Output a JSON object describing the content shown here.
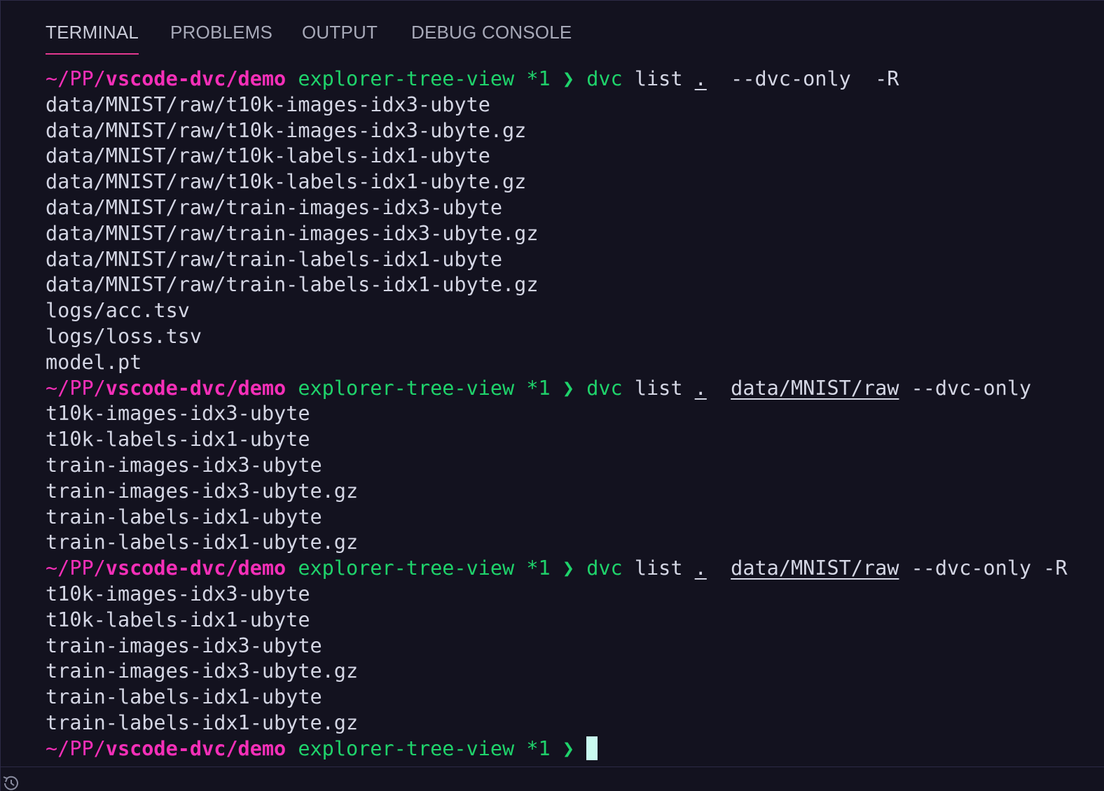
{
  "tabs": [
    {
      "label": "TERMINAL",
      "active": true
    },
    {
      "label": "PROBLEMS",
      "active": false
    },
    {
      "label": "OUTPUT",
      "active": false
    },
    {
      "label": "DEBUG CONSOLE",
      "active": false
    }
  ],
  "prompt": {
    "path_prefix": "~/PP/",
    "path_bold": "vscode-dvc/demo",
    "branch": "explorer-tree-view *1",
    "arrow": "❯"
  },
  "commands": [
    {
      "cmd": "dvc",
      "sub": "list",
      "dot": ".",
      "path": "",
      "flags": "--dvc-only  -R",
      "output": [
        "data/MNIST/raw/t10k-images-idx3-ubyte",
        "data/MNIST/raw/t10k-images-idx3-ubyte.gz",
        "data/MNIST/raw/t10k-labels-idx1-ubyte",
        "data/MNIST/raw/t10k-labels-idx1-ubyte.gz",
        "data/MNIST/raw/train-images-idx3-ubyte",
        "data/MNIST/raw/train-images-idx3-ubyte.gz",
        "data/MNIST/raw/train-labels-idx1-ubyte",
        "data/MNIST/raw/train-labels-idx1-ubyte.gz",
        "logs/acc.tsv",
        "logs/loss.tsv",
        "model.pt"
      ]
    },
    {
      "cmd": "dvc",
      "sub": "list",
      "dot": ".",
      "path": "data/MNIST/raw",
      "flags": "--dvc-only",
      "output": [
        "t10k-images-idx3-ubyte",
        "t10k-labels-idx1-ubyte",
        "train-images-idx3-ubyte",
        "train-images-idx3-ubyte.gz",
        "train-labels-idx1-ubyte",
        "train-labels-idx1-ubyte.gz"
      ]
    },
    {
      "cmd": "dvc",
      "sub": "list",
      "dot": ".",
      "path": "data/MNIST/raw",
      "flags": "--dvc-only -R",
      "output": [
        "t10k-images-idx3-ubyte",
        "t10k-labels-idx1-ubyte",
        "train-images-idx3-ubyte",
        "train-images-idx3-ubyte.gz",
        "train-labels-idx1-ubyte",
        "train-labels-idx1-ubyte.gz"
      ]
    }
  ],
  "colors": {
    "background": "#13121f",
    "prompt_path": "#f52fb8",
    "prompt_branch": "#1fd36b",
    "text": "#d4d6e4",
    "cursor": "#c9fbf0",
    "tab_underline": "#e2388f"
  },
  "icons": {
    "bottom_left": "history-icon"
  }
}
